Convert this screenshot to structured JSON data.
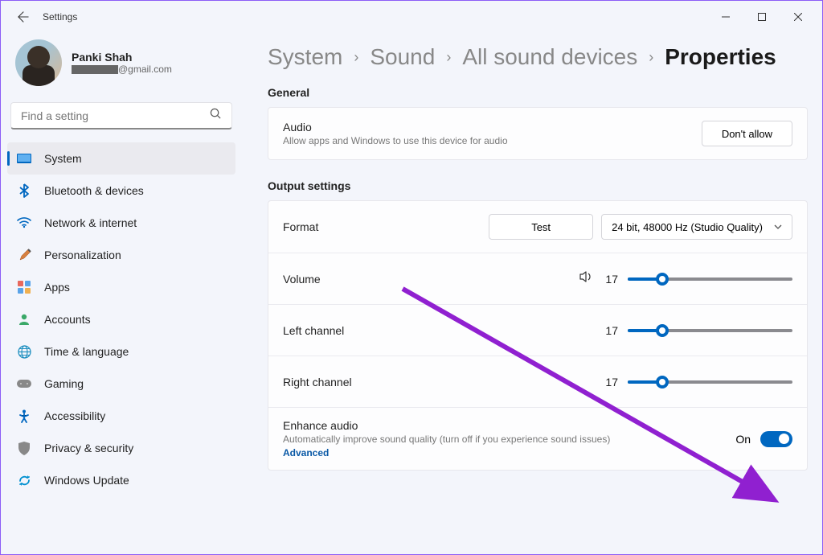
{
  "window": {
    "title": "Settings"
  },
  "profile": {
    "name": "Panki Shah",
    "email_suffix": "@gmail.com"
  },
  "search": {
    "placeholder": "Find a setting"
  },
  "nav": {
    "items": [
      {
        "label": "System",
        "icon": "🖥️"
      },
      {
        "label": "Bluetooth & devices",
        "icon": "bt"
      },
      {
        "label": "Network & internet",
        "icon": "wifi"
      },
      {
        "label": "Personalization",
        "icon": "🖌️"
      },
      {
        "label": "Apps",
        "icon": "apps"
      },
      {
        "label": "Accounts",
        "icon": "acct"
      },
      {
        "label": "Time & language",
        "icon": "🌐"
      },
      {
        "label": "Gaming",
        "icon": "🎮"
      },
      {
        "label": "Accessibility",
        "icon": "acc"
      },
      {
        "label": "Privacy & security",
        "icon": "🛡️"
      },
      {
        "label": "Windows Update",
        "icon": "upd"
      }
    ]
  },
  "breadcrumbs": [
    "System",
    "Sound",
    "All sound devices",
    "Properties"
  ],
  "general": {
    "section": "General",
    "audio_title": "Audio",
    "audio_sub": "Allow apps and Windows to use this device for audio",
    "dont_allow": "Don't allow"
  },
  "output": {
    "section": "Output settings",
    "format": {
      "label": "Format",
      "test": "Test",
      "selected": "24 bit, 48000 Hz (Studio Quality)"
    },
    "volume": {
      "label": "Volume",
      "value": "17",
      "pct": 17
    },
    "left": {
      "label": "Left channel",
      "value": "17",
      "pct": 17
    },
    "right": {
      "label": "Right channel",
      "value": "17",
      "pct": 17
    },
    "enhance": {
      "title": "Enhance audio",
      "sub": "Automatically improve sound quality (turn off if you experience sound issues)",
      "advanced": "Advanced",
      "state": "On"
    }
  }
}
